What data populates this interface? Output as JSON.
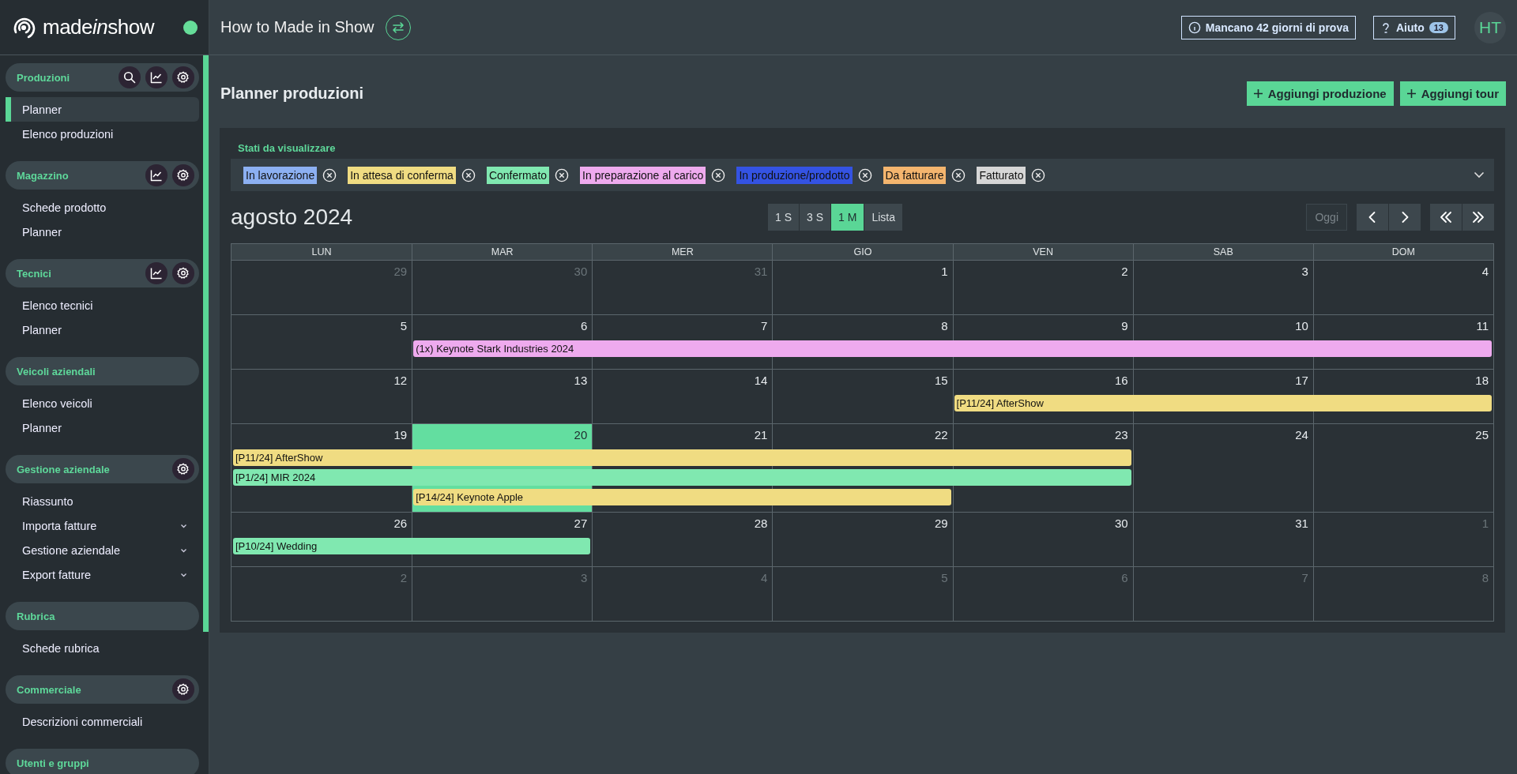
{
  "sidebar": {
    "logo": [
      {
        "text": "made",
        "italic": false
      },
      {
        "text": "in",
        "italic": true
      },
      {
        "text": "show",
        "italic": false
      }
    ],
    "online": true,
    "sections": [
      {
        "title": "Produzioni",
        "actions": [
          {
            "kind": "search"
          },
          {
            "kind": "chart"
          },
          {
            "kind": "settings"
          }
        ],
        "items": [
          {
            "label": "Planner",
            "selected": true,
            "expandable": false
          },
          {
            "label": "Elenco produzioni",
            "selected": false,
            "expandable": false
          }
        ]
      },
      {
        "title": "Magazzino",
        "actions": [
          {
            "kind": "chart"
          },
          {
            "kind": "settings"
          }
        ],
        "items": [
          {
            "label": "Schede prodotto",
            "selected": false,
            "expandable": false
          },
          {
            "label": "Planner",
            "selected": false,
            "expandable": false
          }
        ]
      },
      {
        "title": "Tecnici",
        "actions": [
          {
            "kind": "chart"
          },
          {
            "kind": "settings"
          }
        ],
        "items": [
          {
            "label": "Elenco tecnici",
            "selected": false,
            "expandable": false
          },
          {
            "label": "Planner",
            "selected": false,
            "expandable": false
          }
        ]
      },
      {
        "title": "Veicoli aziendali",
        "items": [
          {
            "label": "Elenco veicoli",
            "selected": false,
            "expandable": false
          },
          {
            "label": "Planner",
            "selected": false,
            "expandable": false
          }
        ]
      },
      {
        "title": "Gestione aziendale",
        "actions": [
          {
            "kind": "settings"
          }
        ],
        "items": [
          {
            "label": "Riassunto",
            "selected": false,
            "expandable": false
          },
          {
            "label": "Importa fatture",
            "selected": false,
            "expandable": true
          },
          {
            "label": "Gestione aziendale",
            "selected": false,
            "expandable": true
          },
          {
            "label": "Export fatture",
            "selected": false,
            "expandable": true
          }
        ]
      },
      {
        "title": "Rubrica",
        "items": [
          {
            "label": "Schede rubrica",
            "selected": false,
            "expandable": false
          }
        ]
      },
      {
        "title": "Commerciale",
        "actions": [
          {
            "kind": "settings"
          }
        ],
        "items": [
          {
            "label": "Descrizioni commerciali",
            "selected": false,
            "expandable": false
          }
        ]
      },
      {
        "title": "Utenti e gruppi"
      }
    ]
  },
  "header": {
    "workspace": "How to Made in Show",
    "trial": "Mancano 42 giorni di prova",
    "help": {
      "label": "Aiuto",
      "count": "13"
    },
    "avatar": "HT"
  },
  "page": {
    "title": "Planner produzioni",
    "buttons": [
      "Aggiungi produzione",
      "Aggiungi tour"
    ]
  },
  "filters": {
    "label": "Stati da visualizzare",
    "tags": [
      {
        "label": "In lavorazione",
        "color": "#8cb0f2"
      },
      {
        "label": "In attesa di conferma",
        "color": "#f0dc82"
      },
      {
        "label": "Confermato",
        "color": "#80e8b0"
      },
      {
        "label": "In preparazione al carico",
        "color": "#eeaaee"
      },
      {
        "label": "In produzione/prodotto",
        "color": "#3453e3"
      },
      {
        "label": "Da fatturare",
        "color": "#f4b56e"
      },
      {
        "label": "Fatturato",
        "color": "#d6d6d6"
      }
    ]
  },
  "calendar": {
    "title": "agosto 2024",
    "views": [
      {
        "label": "1 S",
        "selected": false
      },
      {
        "label": "3 S",
        "selected": false
      },
      {
        "label": "1 M",
        "selected": true
      },
      {
        "label": "Lista",
        "selected": false
      }
    ],
    "today_button": {
      "label": "Oggi",
      "disabled": true
    },
    "weekdays": [
      "LUN",
      "MAR",
      "MER",
      "GIO",
      "VEN",
      "SAB",
      "DOM"
    ],
    "weeks": [
      {
        "days": [
          {
            "label": "29",
            "other_month": true,
            "today": false
          },
          {
            "label": "30",
            "other_month": true,
            "today": false
          },
          {
            "label": "31",
            "other_month": true,
            "today": false
          },
          {
            "label": "1",
            "other_month": false,
            "today": false
          },
          {
            "label": "2",
            "other_month": false,
            "today": false
          },
          {
            "label": "3",
            "other_month": false,
            "today": false
          },
          {
            "label": "4",
            "other_month": false,
            "today": false
          }
        ]
      },
      {
        "days": [
          {
            "label": "5",
            "other_month": false,
            "today": false
          },
          {
            "label": "6",
            "other_month": false,
            "today": false,
            "bars": [
              {
                "kind": "start",
                "label": "(1x) Keynote Stark Industries 2024",
                "color": "#eeaaee"
              }
            ]
          },
          {
            "label": "7",
            "other_month": false,
            "today": false,
            "bars": [
              {
                "kind": "continue"
              }
            ]
          },
          {
            "label": "8",
            "other_month": false,
            "today": false,
            "bars": [
              {
                "kind": "continue"
              }
            ]
          },
          {
            "label": "9",
            "other_month": false,
            "today": false,
            "bars": [
              {
                "kind": "continue"
              }
            ]
          },
          {
            "label": "10",
            "other_month": false,
            "today": false,
            "bars": [
              {
                "kind": "continue"
              }
            ]
          },
          {
            "label": "11",
            "other_month": false,
            "today": false,
            "bars": [
              {
                "kind": "continue"
              }
            ]
          }
        ]
      },
      {
        "days": [
          {
            "label": "12",
            "other_month": false,
            "today": false
          },
          {
            "label": "13",
            "other_month": false,
            "today": false
          },
          {
            "label": "14",
            "other_month": false,
            "today": false
          },
          {
            "label": "15",
            "other_month": false,
            "today": false
          },
          {
            "label": "16",
            "other_month": false,
            "today": false,
            "bars": [
              {
                "kind": "start",
                "label": "[P11/24] AfterShow",
                "color": "#f0dc82"
              }
            ]
          },
          {
            "label": "17",
            "other_month": false,
            "today": false,
            "bars": [
              {
                "kind": "continue"
              }
            ]
          },
          {
            "label": "18",
            "other_month": false,
            "today": false,
            "bars": [
              {
                "kind": "continue"
              }
            ]
          }
        ]
      },
      {
        "days": [
          {
            "label": "19",
            "other_month": false,
            "today": false,
            "bars": [
              {
                "kind": "start",
                "label": "[P11/24] AfterShow",
                "color": "#f0dc82"
              },
              {
                "kind": "start",
                "label": "[P1/24] MIR 2024",
                "color": "#80e8b0"
              }
            ]
          },
          {
            "label": "20",
            "other_month": false,
            "today": true,
            "bars": [
              {
                "kind": "continue"
              },
              {
                "kind": "continue"
              },
              {
                "kind": "start",
                "label": "[P14/24] Keynote Apple",
                "color": "#f0dc82"
              }
            ]
          },
          {
            "label": "21",
            "other_month": false,
            "today": false,
            "bars": [
              {
                "kind": "continue"
              },
              {
                "kind": "continue"
              },
              {
                "kind": "continue"
              }
            ]
          },
          {
            "label": "22",
            "other_month": false,
            "today": false,
            "bars": [
              {
                "kind": "continue"
              },
              {
                "kind": "continue"
              },
              {
                "kind": "continue"
              }
            ]
          },
          {
            "label": "23",
            "other_month": false,
            "today": false,
            "bars": [
              {
                "kind": "continue"
              },
              {
                "kind": "continue"
              }
            ]
          },
          {
            "label": "24",
            "other_month": false,
            "today": false
          },
          {
            "label": "25",
            "other_month": false,
            "today": false
          }
        ]
      },
      {
        "days": [
          {
            "label": "26",
            "other_month": false,
            "today": false,
            "bars": [
              {
                "kind": "start",
                "label": "[P10/24] Wedding",
                "color": "#80e8b0"
              }
            ]
          },
          {
            "label": "27",
            "other_month": false,
            "today": false,
            "bars": [
              {
                "kind": "continue"
              }
            ]
          },
          {
            "label": "28",
            "other_month": false,
            "today": false
          },
          {
            "label": "29",
            "other_month": false,
            "today": false
          },
          {
            "label": "30",
            "other_month": false,
            "today": false
          },
          {
            "label": "31",
            "other_month": false,
            "today": false
          },
          {
            "label": "1",
            "other_month": true,
            "today": false
          }
        ]
      },
      {
        "days": [
          {
            "label": "2",
            "other_month": true,
            "today": false
          },
          {
            "label": "3",
            "other_month": true,
            "today": false
          },
          {
            "label": "4",
            "other_month": true,
            "today": false
          },
          {
            "label": "5",
            "other_month": true,
            "today": false
          },
          {
            "label": "6",
            "other_month": true,
            "today": false
          },
          {
            "label": "7",
            "other_month": true,
            "today": false
          },
          {
            "label": "8",
            "other_month": true,
            "today": false
          }
        ]
      }
    ]
  }
}
